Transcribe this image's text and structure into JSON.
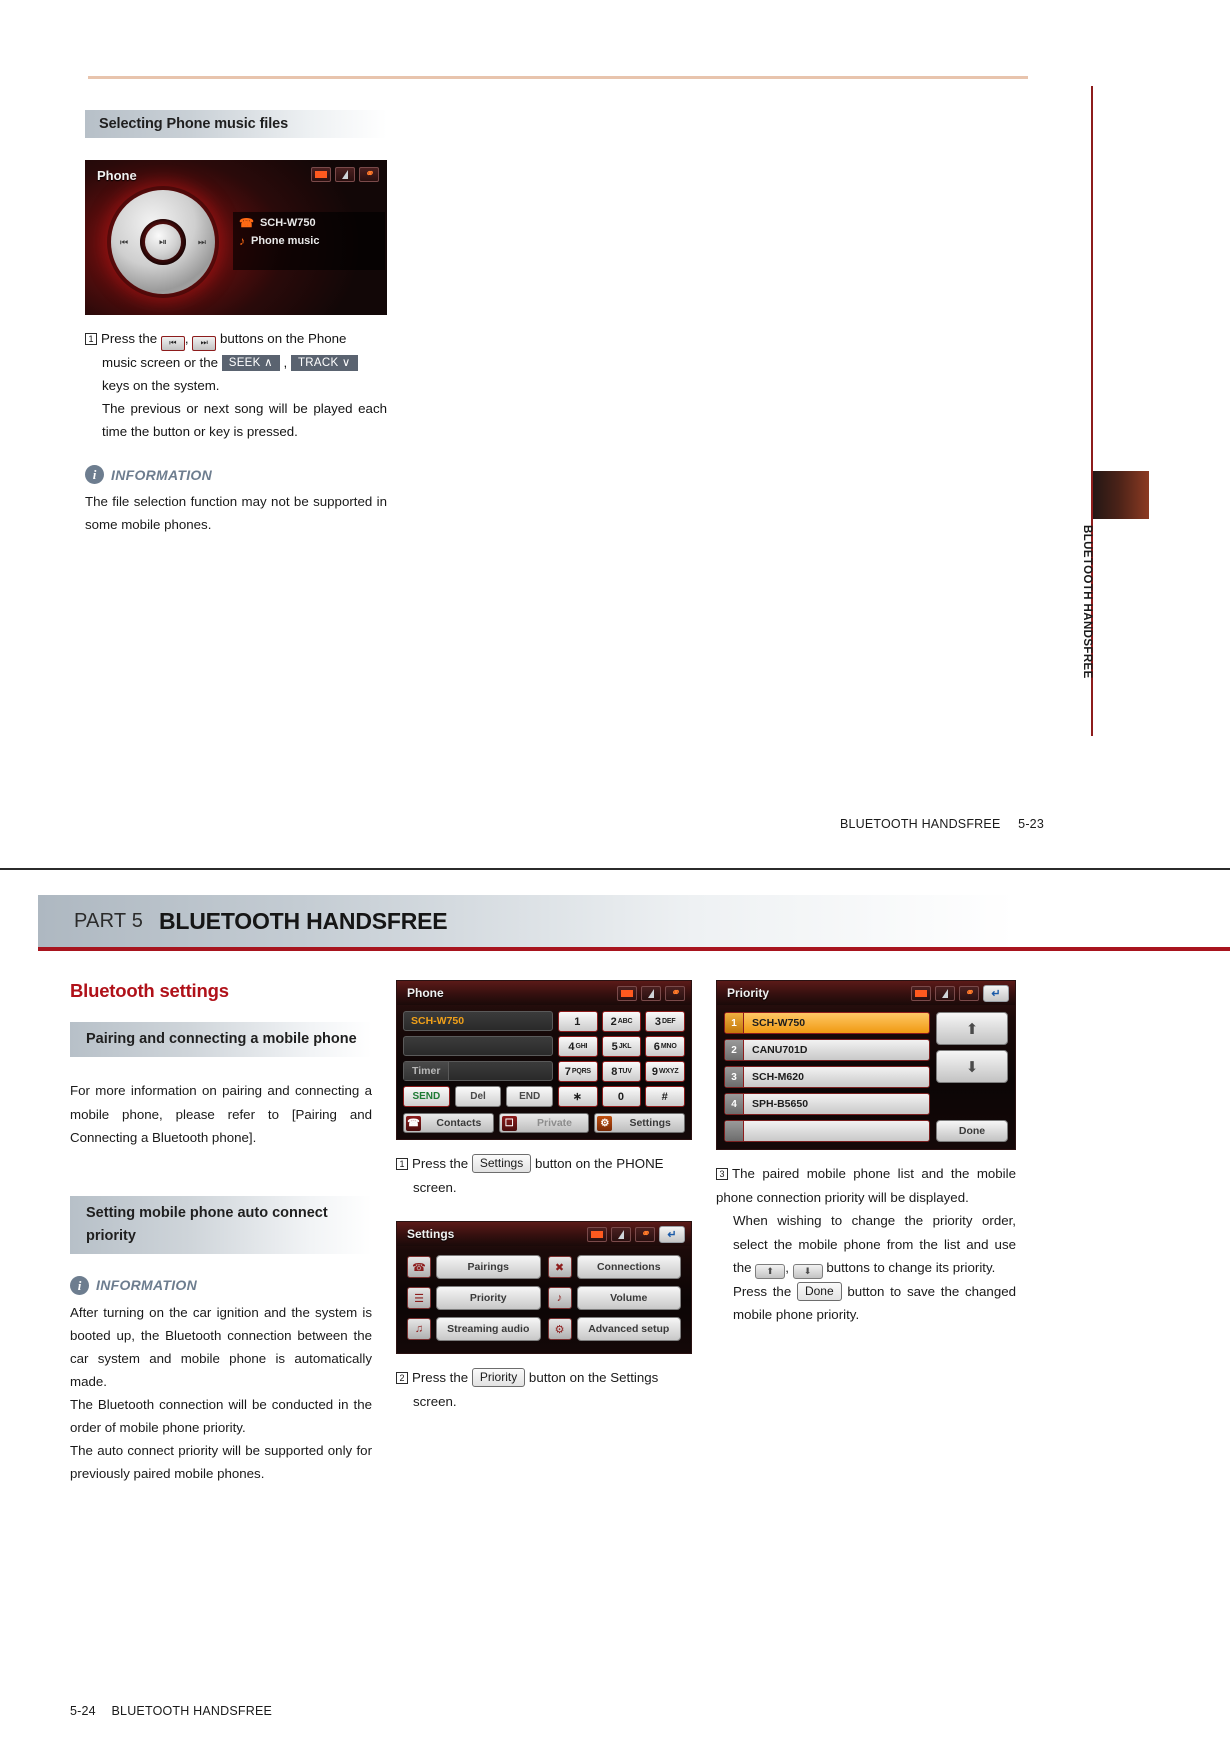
{
  "page1": {
    "section_heading": "Selecting Phone music files",
    "device_screen": {
      "title": "Phone",
      "status_icons": [
        "battery-icon",
        "signal-icon",
        "bluetooth-icon"
      ],
      "wheel": {
        "prev": "⏮",
        "play_pause": "⏯",
        "next": "⏭"
      },
      "track_device": "SCH-W750",
      "track_source": "Phone music"
    },
    "step1": {
      "num": "1",
      "line1_a": "Press the",
      "btn_prev": "⏮",
      "comma": ",",
      "btn_next": "⏭",
      "line1_b": "buttons on the Phone",
      "line2_a": "music screen or the",
      "key_seek": "SEEK ∧",
      "key_track": "TRACK ∨",
      "line3": "keys on the system.",
      "line4": "The previous or next song will be played each time the button or key is pressed."
    },
    "information": {
      "badge": "i",
      "label": "INFORMATION",
      "body": "The file selection function may not be supported in some mobile phones."
    },
    "side_tab": "BLUETOOTH HANDSFREE",
    "footer_text": "BLUETOOTH HANDSFREE",
    "footer_page": "5-23"
  },
  "page2": {
    "part_label": "PART 5",
    "part_title": "BLUETOOTH HANDSFREE",
    "left": {
      "red_heading": "Bluetooth settings",
      "grey_heading_1": "Pairing and connecting a mobile phone",
      "paragraph_1": "For more information on pairing and connecting a mobile phone, please refer to [Pairing and Connecting a Bluetooth phone].",
      "grey_heading_2": "Setting mobile phone auto connect priority",
      "information": {
        "badge": "i",
        "label": "INFORMATION",
        "body_1": "After turning on the car ignition and the system is booted up, the Bluetooth connection between the car system and mobile phone is automatically made.",
        "body_2": "The Bluetooth connection will be conducted in the order of mobile phone priority.",
        "body_3": "The auto connect priority will be supported only for previously paired mobile phones."
      }
    },
    "phone_screen": {
      "title": "Phone",
      "status_icons": [
        "battery-icon",
        "signal-icon",
        "bluetooth-icon"
      ],
      "field_device": "SCH-W750",
      "field_blank": "",
      "timer_label": "Timer",
      "timer_value": "",
      "btn_send": "SEND",
      "btn_del": "Del",
      "btn_end": "END",
      "keys": [
        {
          "d": "1",
          "l": ""
        },
        {
          "d": "2",
          "l": "ABC"
        },
        {
          "d": "3",
          "l": "DEF"
        },
        {
          "d": "4",
          "l": "GHI"
        },
        {
          "d": "5",
          "l": "JKL"
        },
        {
          "d": "6",
          "l": "MNO"
        },
        {
          "d": "7",
          "l": "PQRS"
        },
        {
          "d": "8",
          "l": "TUV"
        },
        {
          "d": "9",
          "l": "WXYZ"
        },
        {
          "d": "∗",
          "l": ""
        },
        {
          "d": "0",
          "l": ""
        },
        {
          "d": "#",
          "l": ""
        }
      ],
      "tab_contacts": "Contacts",
      "tab_private": "Private",
      "tab_settings": "Settings"
    },
    "caption_1": {
      "num": "1",
      "a": "Press the",
      "btn": "Settings",
      "b": "button on the PHONE",
      "line2": "screen."
    },
    "settings_screen": {
      "title": "Settings",
      "status_icons": [
        "battery-icon",
        "signal-icon",
        "bluetooth-icon"
      ],
      "back": "↵",
      "items": [
        {
          "label": "Pairings",
          "icon": "pairings-icon"
        },
        {
          "label": "Connections",
          "icon": "connections-icon"
        },
        {
          "label": "Priority",
          "icon": "priority-icon"
        },
        {
          "label": "Volume",
          "icon": "volume-icon"
        },
        {
          "label": "Streaming audio",
          "icon": "streaming-audio-icon"
        },
        {
          "label": "Advanced setup",
          "icon": "advanced-setup-icon"
        }
      ]
    },
    "caption_2": {
      "num": "2",
      "a": "Press the",
      "btn": "Priority",
      "b": "button on the Settings",
      "line2": "screen."
    },
    "priority_screen": {
      "title": "Priority",
      "status_icons": [
        "battery-icon",
        "signal-icon",
        "bluetooth-icon"
      ],
      "back": "↵",
      "rows": [
        {
          "n": "1",
          "name": "SCH-W750",
          "selected": true
        },
        {
          "n": "2",
          "name": "CANU701D",
          "selected": false
        },
        {
          "n": "3",
          "name": "SCH-M620",
          "selected": false
        },
        {
          "n": "4",
          "name": "SPH-B5650",
          "selected": false
        },
        {
          "n": "",
          "name": "",
          "selected": false
        }
      ],
      "btn_up": "⬆",
      "btn_down": "⬇",
      "btn_done": "Done"
    },
    "caption_3": {
      "num": "3",
      "line1": "The paired mobile phone list and the mobile phone connection priority will be displayed.",
      "line2_a": "When wishing to change the priority order, select the mobile phone from the list and use the",
      "arr_up": "⬆",
      "comma": ",",
      "arr_down": "⬇",
      "line2_b": "buttons to change its priority.",
      "line3_a": "Press the",
      "btn_done": "Done",
      "line3_b": "button to save the changed mobile phone priority."
    },
    "footer_page": "5-24",
    "footer_text": "BLUETOOTH HANDSFREE"
  }
}
